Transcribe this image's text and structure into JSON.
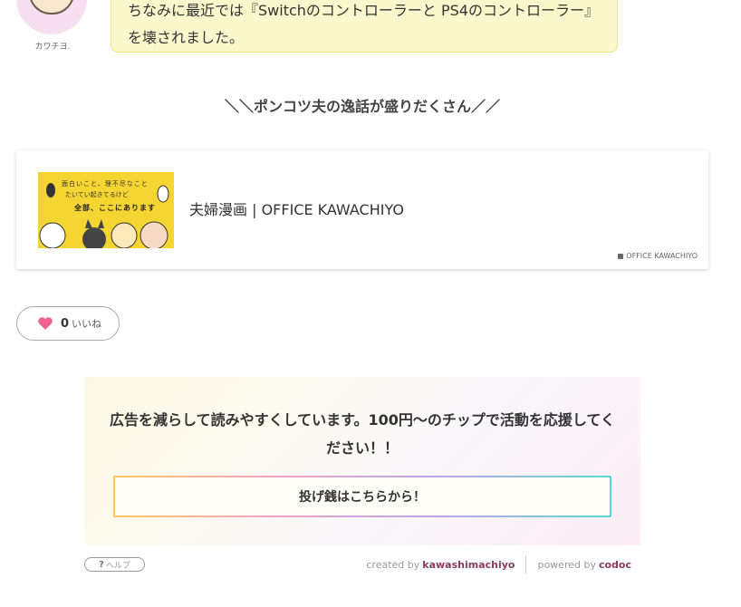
{
  "comment": {
    "author": "カワチヨ.",
    "text": "ちなみに最近では『Switchのコントローラーと PS4のコントローラー』を壊されました。"
  },
  "intro_heading": "＼＼ポンコツ夫の逸話が盛りだくさん／／",
  "blogcard": {
    "title": "夫婦漫画 | OFFICE KAWACHIYO",
    "site": "OFFICE KAWACHIYO",
    "thumb_lines": [
      "面白いこと、理不尽なこと",
      "たいてい起きてるけど",
      "全部、ここにあります"
    ]
  },
  "like": {
    "count": "0",
    "label": "いいね"
  },
  "tip": {
    "message": "広告を減らして読みやすくしています。100円〜のチップで活動を応援してください！！",
    "button_label": "投げ銭はこちらから！"
  },
  "footer": {
    "help_label": "ヘルプ",
    "created_by_prefix": "created by",
    "created_by_name": "kawashimachiyo",
    "powered_by_prefix": "powered by",
    "powered_by_name": "codoc"
  },
  "colors": {
    "bubble_bg": "#fbf7cd",
    "heart": "#f06292",
    "credit_name": "#8a3b5e"
  }
}
